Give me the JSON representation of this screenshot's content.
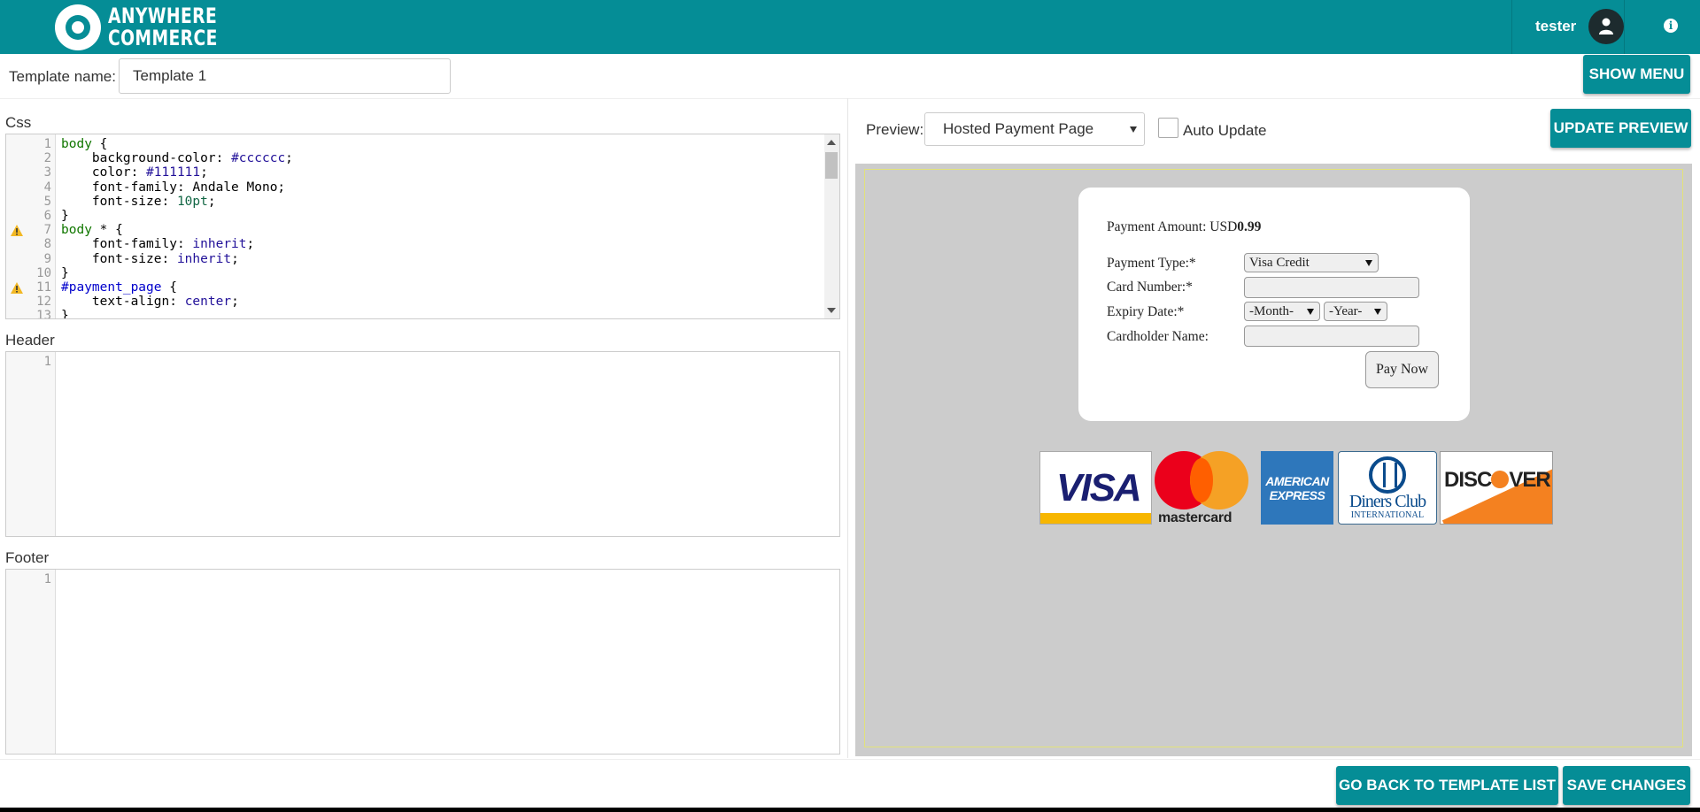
{
  "app": {
    "logo_line1": "ANYWHERE",
    "logo_line2": "COMMERCE",
    "brand_color": "#058d96"
  },
  "header": {
    "username": "tester",
    "user_icon": "user-icon",
    "info_icon": "info-icon"
  },
  "template": {
    "label": "Template name:",
    "value": "Template 1",
    "show_menu": "SHOW MENU"
  },
  "editors": {
    "css_label": "Css",
    "header_label": "Header",
    "footer_label": "Footer",
    "css_lines": [
      {
        "n": "1",
        "parts": [
          [
            "kw",
            "body"
          ],
          [
            "",
            " {"
          ]
        ]
      },
      {
        "n": "2",
        "parts": [
          [
            "",
            "    background-color: "
          ],
          [
            "val",
            "#cccccc"
          ],
          [
            "",
            ";"
          ]
        ]
      },
      {
        "n": "3",
        "parts": [
          [
            "",
            "    color: "
          ],
          [
            "val",
            "#111111"
          ],
          [
            "",
            ";"
          ]
        ]
      },
      {
        "n": "4",
        "parts": [
          [
            "",
            "    font-family: Andale Mono;"
          ]
        ]
      },
      {
        "n": "5",
        "parts": [
          [
            "",
            "    font-size: "
          ],
          [
            "num",
            "10pt"
          ],
          [
            "",
            ";"
          ]
        ]
      },
      {
        "n": "6",
        "parts": [
          [
            "",
            "}"
          ]
        ]
      },
      {
        "n": "7",
        "parts": [
          [
            "kw",
            "body"
          ],
          [
            "",
            " * {"
          ]
        ],
        "warn": true
      },
      {
        "n": "8",
        "parts": [
          [
            "",
            "    font-family: "
          ],
          [
            "val",
            "inherit"
          ],
          [
            "",
            ";"
          ]
        ]
      },
      {
        "n": "9",
        "parts": [
          [
            "",
            "    font-size: "
          ],
          [
            "val",
            "inherit"
          ],
          [
            "",
            ";"
          ]
        ]
      },
      {
        "n": "10",
        "parts": [
          [
            "",
            "}"
          ]
        ]
      },
      {
        "n": "11",
        "parts": [
          [
            "id",
            "#payment_page"
          ],
          [
            "",
            " {"
          ]
        ],
        "warn": true
      },
      {
        "n": "12",
        "parts": [
          [
            "",
            "    text-align: "
          ],
          [
            "val",
            "center"
          ],
          [
            "",
            ";"
          ]
        ]
      },
      {
        "n": "13",
        "parts": [
          [
            "",
            "}"
          ]
        ]
      }
    ],
    "header_line": "1",
    "footer_line": "1"
  },
  "preview": {
    "label": "Preview:",
    "selected": "Hosted Payment Page",
    "auto_update_label": "Auto Update",
    "auto_update_checked": false,
    "update_button": "UPDATE PREVIEW"
  },
  "payment_form": {
    "amount_label": "Payment Amount: USD",
    "amount_value": "0.99",
    "payment_type_label": "Payment Type:*",
    "payment_type_value": "Visa Credit",
    "card_number_label": "Card Number:*",
    "expiry_label": "Expiry Date:*",
    "month_value": "-Month-",
    "year_value": "-Year-",
    "cardholder_label": "Cardholder Name:",
    "pay_now": "Pay Now"
  },
  "card_logos": {
    "visa": "VISA",
    "mastercard": "mastercard",
    "amex_line1": "AMERICAN",
    "amex_line2": "EXPRESS",
    "diners_line1": "Diners Club",
    "diners_line2": "INTERNATIONAL",
    "discover_pre": "DISC",
    "discover_post": "VER"
  },
  "footer": {
    "back_button": "GO BACK TO TEMPLATE LIST",
    "save_button": "SAVE CHANGES"
  }
}
